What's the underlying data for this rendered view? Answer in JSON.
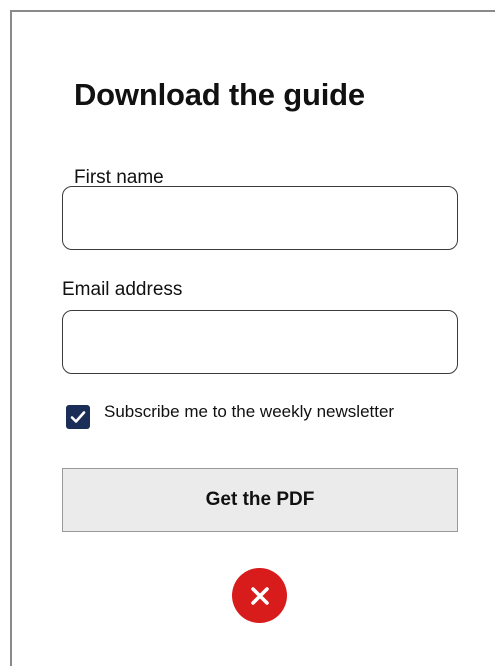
{
  "form": {
    "title": "Download the guide",
    "first_name_label": "First name",
    "first_name_value": "",
    "email_label": "Email address",
    "email_value": "",
    "newsletter_label": "Subscribe me to the weekly newsletter",
    "newsletter_checked": true,
    "submit_label": "Get the PDF"
  },
  "icons": {
    "checkbox": "checkmark-icon",
    "close": "close-icon"
  },
  "colors": {
    "checkbox_fill": "#1a2e57",
    "close_button": "#d81b1b",
    "submit_background": "#ebebeb",
    "frame_border": "#8a8a8a"
  }
}
